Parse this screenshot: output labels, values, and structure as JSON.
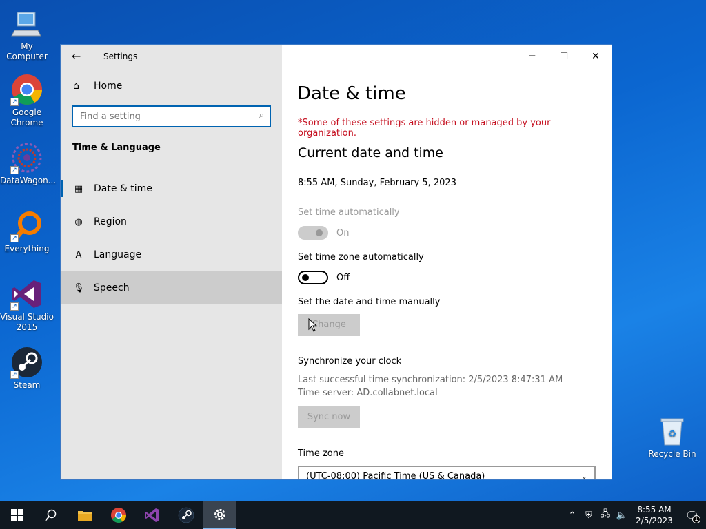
{
  "desktop": {
    "icons": [
      {
        "label": "My Computer"
      },
      {
        "label": "Google Chrome"
      },
      {
        "label": "DataWagon..."
      },
      {
        "label": "Everything"
      },
      {
        "label": "Visual Studio 2015"
      },
      {
        "label": "Steam"
      },
      {
        "label": "Recycle Bin"
      }
    ]
  },
  "window": {
    "app_title": "Settings",
    "nav": {
      "home_label": "Home",
      "search_placeholder": "Find a setting",
      "section_title": "Time & Language",
      "items": [
        {
          "label": "Date & time",
          "icon": "calendar-clock-icon"
        },
        {
          "label": "Region",
          "icon": "globe-icon"
        },
        {
          "label": "Language",
          "icon": "language-icon"
        },
        {
          "label": "Speech",
          "icon": "microphone-icon"
        }
      ]
    },
    "content": {
      "page_title": "Date & time",
      "warning": "*Some of these settings are hidden or managed by your organization.",
      "section_current": "Current date and time",
      "current_datetime": "8:55 AM, Sunday, February 5, 2023",
      "set_time_auto_label": "Set time automatically",
      "set_time_auto_state": "On",
      "set_tz_auto_label": "Set time zone automatically",
      "set_tz_auto_state": "Off",
      "manual_label": "Set the date and time manually",
      "change_button": "Change",
      "sync_title": "Synchronize your clock",
      "sync_last": "Last successful time synchronization: 2/5/2023 8:47:31 AM",
      "sync_server": "Time server: AD.collabnet.local",
      "sync_button": "Sync now",
      "timezone_label": "Time zone",
      "timezone_value": "(UTC-08:00) Pacific Time (US & Canada)"
    }
  },
  "taskbar": {
    "time": "8:55 AM",
    "date": "2/5/2023",
    "notification_count": "1"
  }
}
